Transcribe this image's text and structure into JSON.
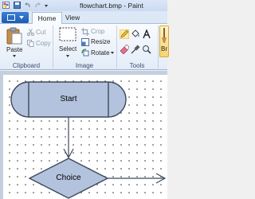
{
  "window": {
    "title": "flowchart.bmp - Paint"
  },
  "tabs": [
    "Home",
    "View"
  ],
  "clipboard": {
    "paste": "Paste",
    "cut": "Cut",
    "copy": "Copy",
    "group": "Clipboard"
  },
  "image": {
    "select": "Select",
    "crop": "Crop",
    "resize": "Resize",
    "rotate": "Rotate",
    "group": "Image"
  },
  "tools": {
    "group": "Tools",
    "brushes_partial": "Br"
  },
  "flowchart": {
    "start": "Start",
    "choice": "Choice"
  },
  "colors": {
    "accent": "#1d5bb2",
    "shape_fill": "#b3c3dd",
    "shape_stroke": "#3d4a5c"
  }
}
